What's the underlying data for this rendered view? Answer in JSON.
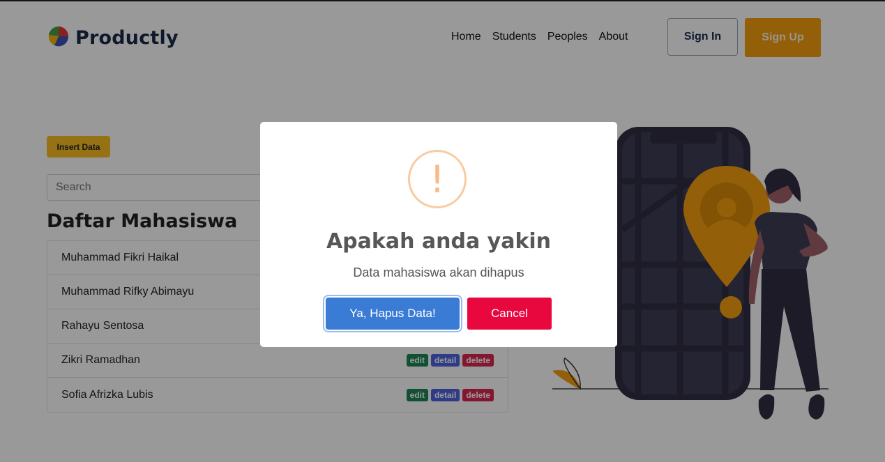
{
  "brand": {
    "name": "Productly",
    "logo_icon": "pie-logo-icon"
  },
  "nav": {
    "items": [
      "Home",
      "Students",
      "Peoples",
      "About"
    ]
  },
  "auth": {
    "sign_in": "Sign In",
    "sign_up": "Sign Up"
  },
  "main": {
    "insert_label": "Insert Data",
    "search_placeholder": "Search",
    "list_title": "Daftar Mahasiswa",
    "badges": {
      "edit": "edit",
      "detail": "detail",
      "delete": "delete"
    },
    "students": [
      "Muhammad Fikri Haikal",
      "Muhammad Rifky Abimayu",
      "Rahayu Sentosa",
      "Zikri Ramadhan",
      "Sofia Afrizka Lubis"
    ]
  },
  "modal": {
    "icon": "warning-icon",
    "icon_glyph": "!",
    "title": "Apakah anda yakin",
    "text": "Data mahasiswa akan dihapus",
    "confirm_label": "Ya, Hapus Data!",
    "cancel_label": "Cancel"
  },
  "colors": {
    "accent": "#f5a00f",
    "insert": "#fbbf24",
    "confirm": "#3a7bd5",
    "cancel": "#e8083e",
    "edit": "#198754",
    "detail": "#4f63e0",
    "delete": "#dc2650"
  }
}
